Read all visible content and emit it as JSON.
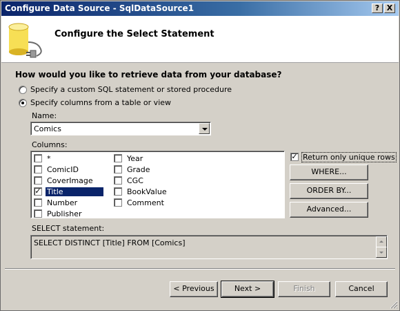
{
  "window": {
    "title": "Configure Data Source - SqlDataSource1",
    "help_button": "?",
    "close_button": "X"
  },
  "header": {
    "title": "Configure the Select Statement",
    "icon": "database-plug-icon"
  },
  "question": "How would you like to retrieve data from your database?",
  "options": [
    {
      "label": "Specify a custom SQL statement or stored procedure",
      "selected": false
    },
    {
      "label": "Specify columns from a table or view",
      "selected": true
    }
  ],
  "name_field": {
    "label": "Name:",
    "value": "Comics"
  },
  "columns": {
    "label": "Columns:",
    "items": [
      {
        "label": "*",
        "checked": false
      },
      {
        "label": "ComicID",
        "checked": false
      },
      {
        "label": "CoverImage",
        "checked": false
      },
      {
        "label": "Title",
        "checked": true
      },
      {
        "label": "Number",
        "checked": false
      },
      {
        "label": "Publisher",
        "checked": false
      },
      {
        "label": "Year",
        "checked": false
      },
      {
        "label": "Grade",
        "checked": false
      },
      {
        "label": "CGC",
        "checked": false
      },
      {
        "label": "BookValue",
        "checked": false
      },
      {
        "label": "Comment",
        "checked": false
      }
    ]
  },
  "unique_rows": {
    "label": "Return only unique rows",
    "checked": true
  },
  "side_buttons": {
    "where": "WHERE...",
    "order_by": "ORDER BY...",
    "advanced": "Advanced..."
  },
  "select_statement": {
    "label": "SELECT statement:",
    "value": "SELECT DISTINCT [Title] FROM [Comics]"
  },
  "footer": {
    "previous": "< Previous",
    "next": "Next >",
    "finish": "Finish",
    "cancel": "Cancel"
  },
  "colors": {
    "title_bar_start": "#0a246a",
    "title_bar_end": "#a6caf0",
    "dialog_bg": "#d4d0c8",
    "selection": "#0a246a"
  }
}
